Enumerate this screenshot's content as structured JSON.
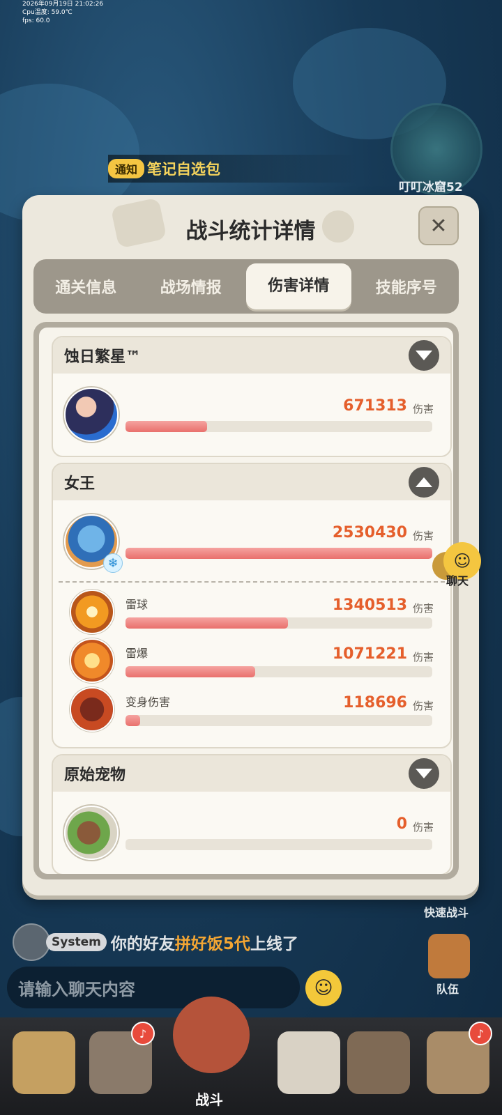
{
  "status": {
    "datetime": "2026年09月19日 21:02:26",
    "cpu": "Cpu温度: 59.0℃",
    "fps": "fps: 60.0"
  },
  "notice": {
    "tag": "通知",
    "text": "笔记自选包"
  },
  "minimap": {
    "label": "叮叮冰窟52"
  },
  "dialog": {
    "title": "战斗统计详情",
    "close_label": "✕",
    "tabs": [
      {
        "label": "通关信息",
        "active": false
      },
      {
        "label": "战场情报",
        "active": false
      },
      {
        "label": "伤害详情",
        "active": true
      },
      {
        "label": "技能序号",
        "active": false
      }
    ],
    "unit": "伤害",
    "players": [
      {
        "name": "蚀日繁星™",
        "expanded": false,
        "damage": "671313",
        "ratio": 0.265
      },
      {
        "name": "女王",
        "expanded": true,
        "damage": "2530430",
        "ratio": 1.0,
        "skills": [
          {
            "name": "雷球",
            "damage": "1340513",
            "ratio": 0.53
          },
          {
            "name": "雷爆",
            "damage": "1071221",
            "ratio": 0.423
          },
          {
            "name": "变身伤害",
            "damage": "118696",
            "ratio": 0.047
          }
        ]
      },
      {
        "name": "原始宠物",
        "expanded": false,
        "damage": "0",
        "ratio": 0
      }
    ]
  },
  "chat": {
    "sys_tag": "System",
    "msg_prefix": "你的好友",
    "msg_friend": "拼好饭5代",
    "msg_suffix": "上线了",
    "input_placeholder": "请输入聊天内容"
  },
  "side": {
    "quick_battle": "快速战斗",
    "team": "队伍",
    "chat_buddy": "聊天"
  },
  "nav": {
    "fight_label": "战斗"
  },
  "colors": {
    "accent": "#e55f2c",
    "bar": "#e9706c",
    "panel": "#ece8dd"
  }
}
